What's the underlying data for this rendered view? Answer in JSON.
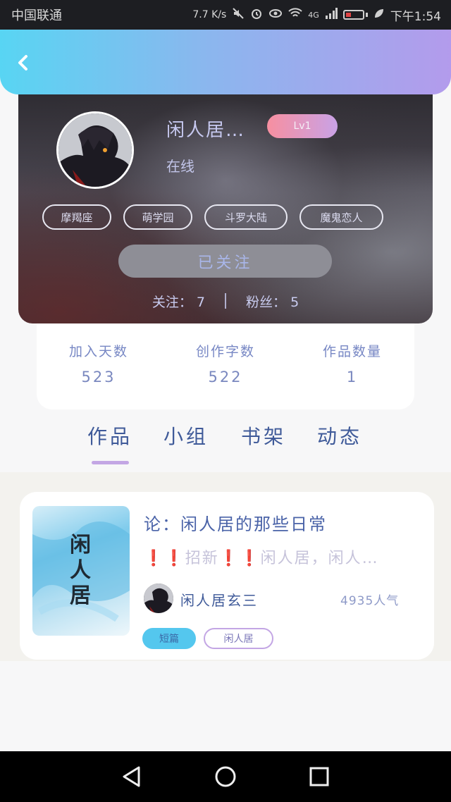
{
  "status_bar": {
    "carrier": "中国联通",
    "speed": "7.7 K/s",
    "network": "4G",
    "time": "下午1:54"
  },
  "profile": {
    "username": "闲人居…",
    "level": "Lv1",
    "online": "在线",
    "tags": [
      "摩羯座",
      "萌学园",
      "斗罗大陆",
      "魔鬼恋人"
    ],
    "follow_button": "已关注",
    "following_label": "关注：",
    "following_count": "7",
    "fans_label": "粉丝：",
    "fans_count": "5"
  },
  "stats": [
    {
      "label": "加入天数",
      "value": "523"
    },
    {
      "label": "创作字数",
      "value": "522"
    },
    {
      "label": "作品数量",
      "value": "1"
    }
  ],
  "tabs": [
    "作品",
    "小组",
    "书架",
    "动态"
  ],
  "work": {
    "title": "论：闲人居的那些日常",
    "description": "❗❗招新❗❗闲人居，闲人…",
    "author": "闲人居玄三",
    "views": "4935人气",
    "type_chip": "短篇",
    "tag_chip": "闲人居",
    "cover_text": "闲人居"
  },
  "colors": {
    "header_start": "#58d5f3",
    "header_end": "#b39bec",
    "accent_purple": "#c3a6e4",
    "accent_blue": "#54c7ee"
  }
}
